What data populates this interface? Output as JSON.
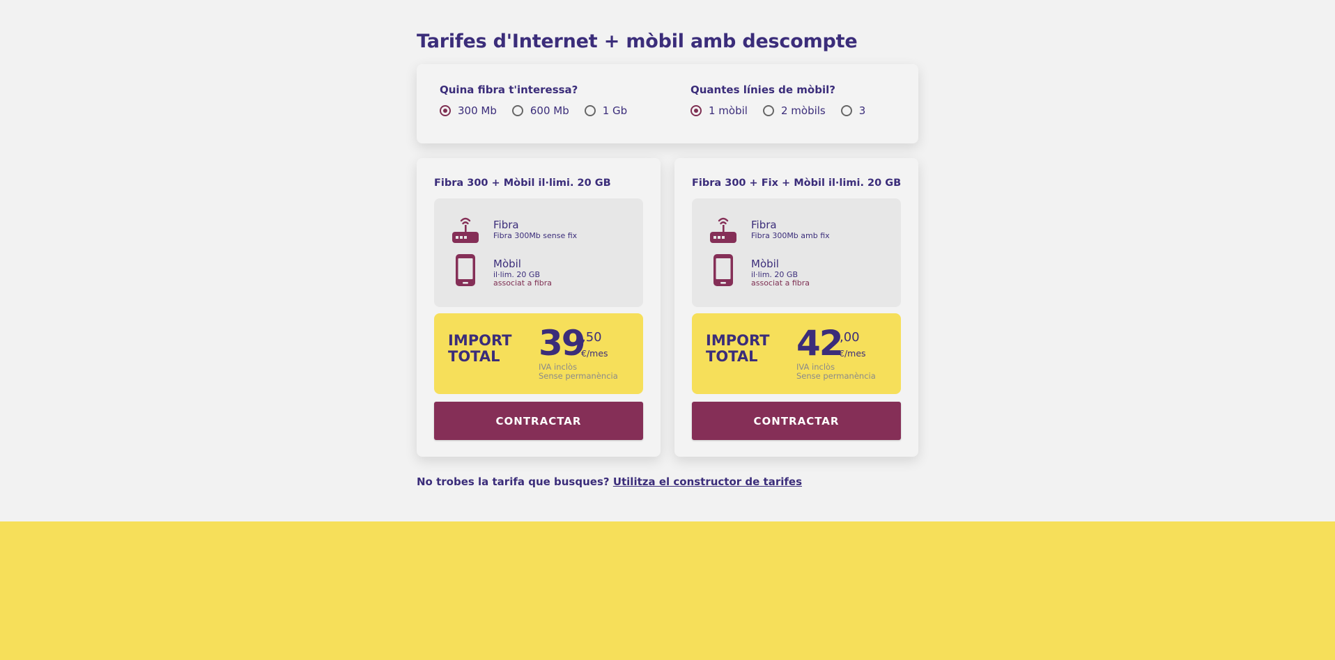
{
  "page": {
    "title": "Tarifes d'Internet + mòbil amb descompte",
    "colors": {
      "brand_purple": "#3b2d7a",
      "brand_wine": "#852f57",
      "accent_yellow": "#f6df5a"
    }
  },
  "filters": {
    "fibra": {
      "label": "Quina fibra t'interessa?",
      "options": [
        "300 Mb",
        "600 Mb",
        "1 Gb"
      ],
      "selected": "300 Mb"
    },
    "mobil": {
      "label": "Quantes línies de mòbil?",
      "options": [
        "1 mòbil",
        "2 mòbils",
        "3"
      ],
      "selected": "1 mòbil"
    }
  },
  "plans": [
    {
      "title": "Fibra 300 + Mòbil il·limi. 20 GB",
      "fibra": {
        "name": "Fibra",
        "desc": "Fibra 300Mb sense fix",
        "icon": "router-icon"
      },
      "mobil": {
        "name": "Mòbil",
        "desc": "il·lim. 20 GB",
        "note": "associat a fibra",
        "icon": "phone-icon"
      },
      "total_label": "IMPORT TOTAL",
      "price_int": "39",
      "price_dec": ",50",
      "price_unit": "€/mes",
      "iva": "IVA inclòs",
      "permanence": "Sense permanència",
      "button": "CONTRACTAR"
    },
    {
      "title": "Fibra 300 + Fix + Mòbil il·limi. 20 GB",
      "fibra": {
        "name": "Fibra",
        "desc": "Fibra 300Mb amb fix",
        "icon": "router-icon"
      },
      "mobil": {
        "name": "Mòbil",
        "desc": "il·lim. 20 GB",
        "note": "associat a fibra",
        "icon": "phone-icon"
      },
      "total_label": "IMPORT TOTAL",
      "price_int": "42",
      "price_dec": ",00",
      "price_unit": "€/mes",
      "iva": "IVA inclòs",
      "permanence": "Sense permanència",
      "button": "CONTRACTAR"
    }
  ],
  "footer": {
    "question": "No trobes la tarifa que busques?",
    "link": "Utilitza el constructor de tarifes"
  }
}
